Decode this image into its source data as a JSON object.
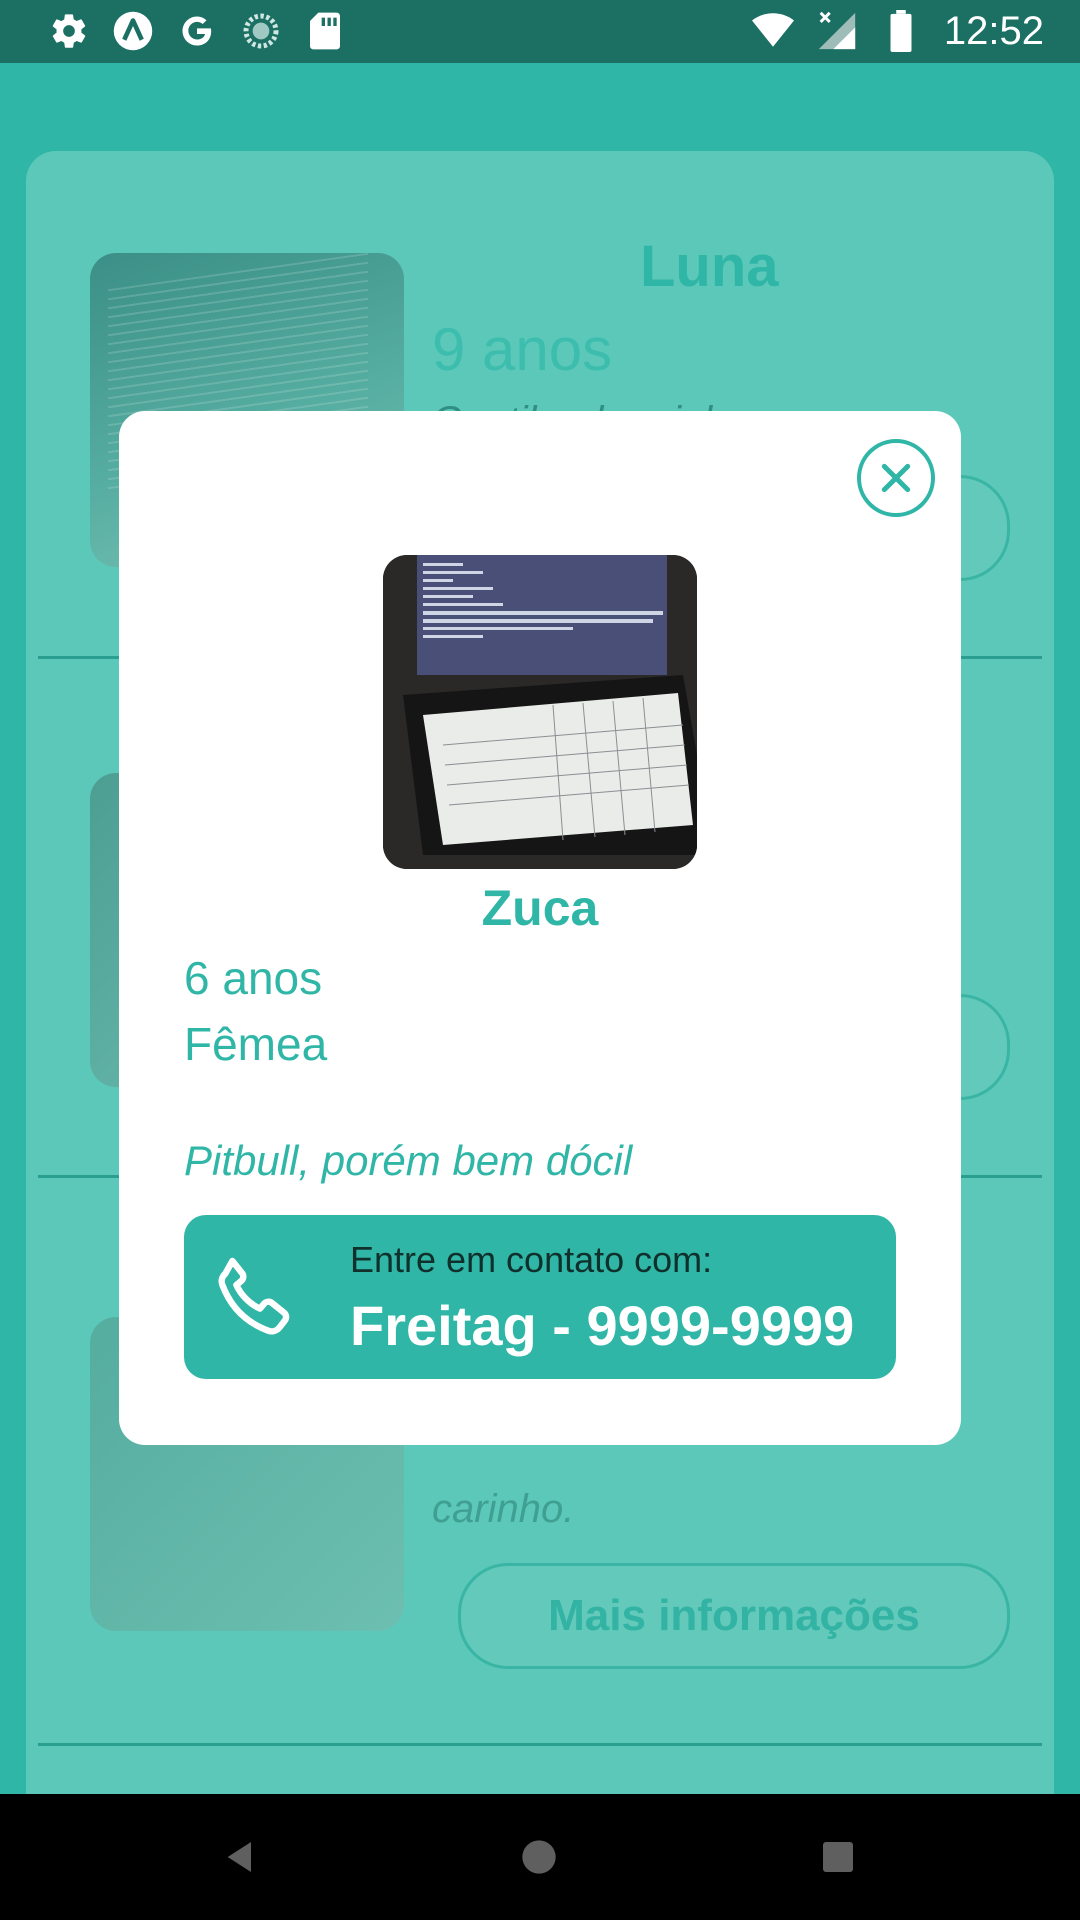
{
  "status_bar": {
    "time": "12:52",
    "left_icons": [
      "gear-icon",
      "app-a-icon",
      "google-icon",
      "sync-icon",
      "sd-card-icon"
    ],
    "right_icons": [
      "wifi-icon",
      "signal-icon",
      "battery-icon"
    ]
  },
  "background_list": {
    "pets": [
      {
        "name": "Luna",
        "age": "9 anos",
        "description": "Gentil e dorminhoca."
      },
      {
        "description_partial": "carinho.",
        "more_button": "Mais informações"
      }
    ]
  },
  "modal": {
    "close_icon": "close-icon",
    "name": "Zuca",
    "age": "6 anos",
    "gender": "Fêmea",
    "description": "Pitbull, porém bem dócil",
    "contact": {
      "label": "Entre em contato com:",
      "value": "Freitag - 9999-9999",
      "icon": "phone-icon"
    }
  },
  "nav_bar": {
    "buttons": [
      "back-icon",
      "home-icon",
      "recents-icon"
    ]
  },
  "colors": {
    "accent": "#2fb6a6",
    "status_bar": "#1b6f63",
    "overlay_card": "#5cc8b9"
  }
}
